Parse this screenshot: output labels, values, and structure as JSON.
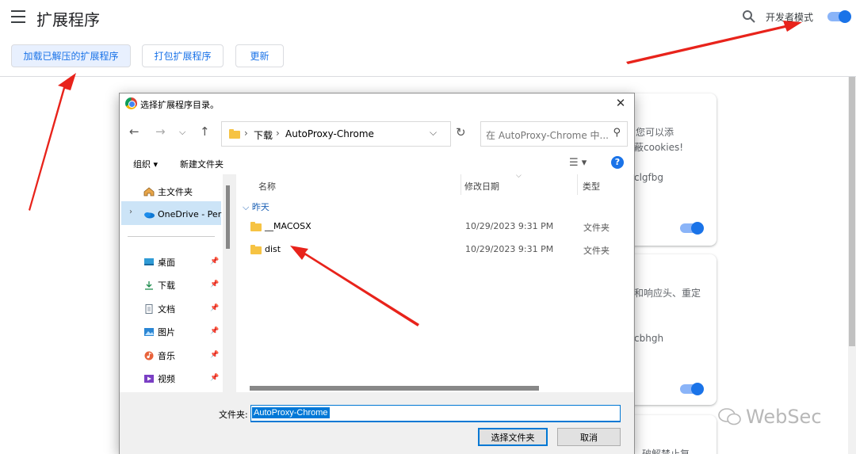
{
  "header": {
    "title": "扩展程序",
    "dev_mode_label": "开发者模式",
    "dev_mode_on": true
  },
  "toolbar": {
    "load_unpacked": "加载已解压的扩展程序",
    "pack": "打包扩展程序",
    "update": "更新"
  },
  "cards": [
    {
      "desc_line1": "。您可以添",
      "desc_line2": "蔽cookies!",
      "id": "clgfbg",
      "enabled": true
    },
    {
      "desc_line1": "和响应头、重定",
      "id": "cbhgh",
      "enabled": true
    },
    {
      "desc_line1": "破解禁止复"
    }
  ],
  "watermark": "WebSec",
  "dialog": {
    "title": "选择扩展程序目录。",
    "path": [
      "下载",
      "AutoProxy-Chrome"
    ],
    "search_placeholder": "在 AutoProxy-Chrome 中...",
    "organize": "组织",
    "new_folder": "新建文件夹",
    "help": "?",
    "nav": [
      {
        "label": "主文件夹",
        "icon": "home-icon",
        "pinned": false
      },
      {
        "label": "OneDrive - Per",
        "icon": "onedrive-icon",
        "pinned": false
      },
      {
        "label": "桌面",
        "icon": "desktop-icon",
        "pinned": true
      },
      {
        "label": "下载",
        "icon": "download-icon",
        "pinned": true
      },
      {
        "label": "文档",
        "icon": "document-icon",
        "pinned": true
      },
      {
        "label": "图片",
        "icon": "pictures-icon",
        "pinned": true
      },
      {
        "label": "音乐",
        "icon": "music-icon",
        "pinned": true
      },
      {
        "label": "视频",
        "icon": "video-icon",
        "pinned": true
      }
    ],
    "columns": {
      "name": "名称",
      "date": "修改日期",
      "type": "类型"
    },
    "group": "昨天",
    "files": [
      {
        "name": "__MACOSX",
        "date": "10/29/2023 9:31 PM",
        "type": "文件夹"
      },
      {
        "name": "dist",
        "date": "10/29/2023 9:31 PM",
        "type": "文件夹"
      }
    ],
    "folder_label": "文件夹:",
    "folder_value": "AutoProxy-Chrome",
    "select_button": "选择文件夹",
    "cancel_button": "取消"
  },
  "colors": {
    "accent": "#1a73e8",
    "annotation_arrow": "#e8231b"
  }
}
